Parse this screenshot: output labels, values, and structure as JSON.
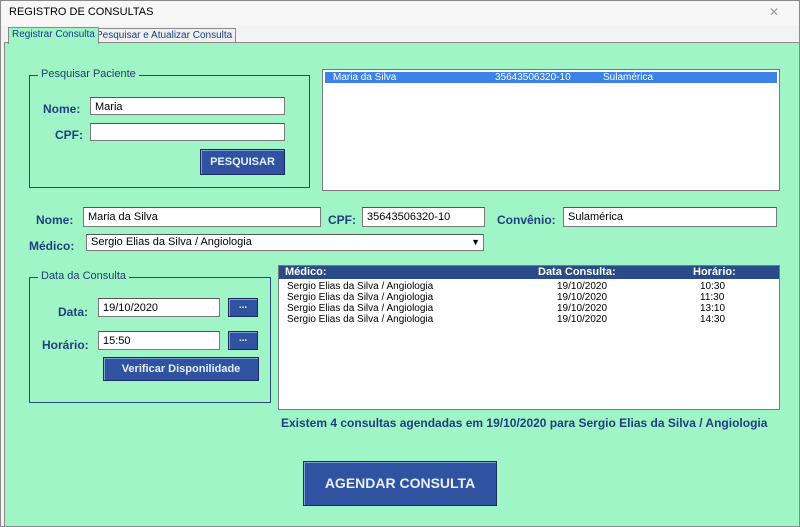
{
  "window": {
    "title": "REGISTRO DE CONSULTAS",
    "close_glyph": "✕"
  },
  "tabs": [
    {
      "label": "Registrar Consulta"
    },
    {
      "label": "Pesquisar e Atualizar Consulta"
    }
  ],
  "search_patient": {
    "frame_title": "Pesquisar Paciente",
    "name_label": "Nome:",
    "name_value": "Maria",
    "cpf_label": "CPF:",
    "cpf_value": "",
    "search_button": "PESQUISAR"
  },
  "results": {
    "rows": [
      {
        "nome": "Maria da Silva",
        "cpf": "35643506320-10",
        "convenio": "Sulamérica"
      }
    ]
  },
  "patient": {
    "nome_label": "Nome:",
    "nome_value": "Maria da Silva",
    "cpf_label": "CPF:",
    "cpf_value": "35643506320-10",
    "convenio_label": "Convênio:",
    "convenio_value": "Sulamérica",
    "medico_label": "Médico:",
    "medico_value": "Sergio Elias da Silva / Angiologia"
  },
  "consulta": {
    "frame_title": "Data da Consulta",
    "data_label": "Data:",
    "data_value": "19/10/2020",
    "horario_label": "Horário:",
    "horario_value": "15:50",
    "picker_button": "...",
    "verify_button": "Verificar Disponilidade"
  },
  "appointments": {
    "headers": [
      "Médico:",
      "Data Consulta:",
      "Horário:"
    ],
    "rows": [
      [
        "Sergio Elias da Silva / Angiologia",
        "19/10/2020",
        "10:30"
      ],
      [
        "Sergio Elias da Silva / Angiologia",
        "19/10/2020",
        "11:30"
      ],
      [
        "Sergio Elias da Silva / Angiologia",
        "19/10/2020",
        "13:10"
      ],
      [
        "Sergio Elias da Silva / Angiologia",
        "19/10/2020",
        "14:30"
      ]
    ]
  },
  "message": "Existem 4 consultas agendadas em 19/10/2020 para Sergio Elias da Silva / Angiologia",
  "agendar_button": "AGENDAR CONSULTA",
  "colors": {
    "form_bg": "#9ff5c6",
    "button_bg": "#2f53a0",
    "label": "#1f3f7f",
    "selection": "#3d82e8"
  }
}
